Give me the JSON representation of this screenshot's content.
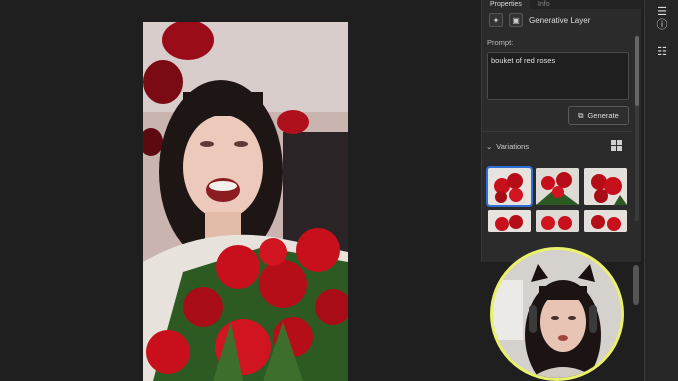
{
  "panel": {
    "tabs": [
      "Properties",
      "Info"
    ],
    "layer_name": "Generative Layer",
    "prompt_label": "Prompt:",
    "prompt_value": "bouket of red roses",
    "generate_label": "Generate",
    "variations_label": "Variations"
  },
  "colors": {
    "accent": "#2f6fd6",
    "webcam_ring": "#e9f06a",
    "rose": "#c8101c"
  }
}
